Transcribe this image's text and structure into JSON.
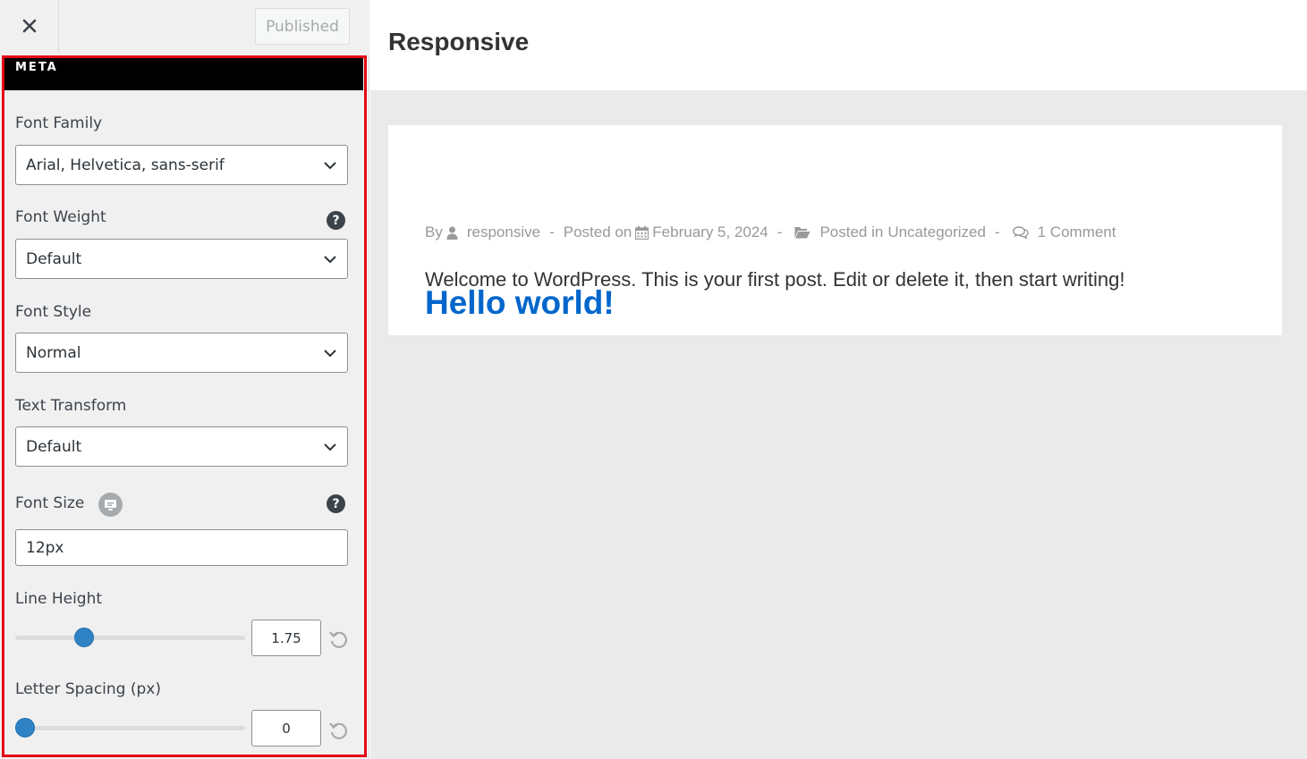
{
  "panel": {
    "close_label": "×",
    "publish_button": "Published",
    "section_title": "META",
    "font_family": {
      "label": "Font Family",
      "value": "Arial, Helvetica, sans-serif"
    },
    "font_weight": {
      "label": "Font Weight",
      "value": "Default",
      "help": "?"
    },
    "font_style": {
      "label": "Font Style",
      "value": "Normal"
    },
    "text_transform": {
      "label": "Text Transform",
      "value": "Default"
    },
    "font_size": {
      "label": "Font Size",
      "value": "12px",
      "help": "?"
    },
    "line_height": {
      "label": "Line Height",
      "value": "1.75",
      "slider_fraction": 0.28
    },
    "letter_spacing": {
      "label": "Letter Spacing (px)",
      "value": "0",
      "slider_fraction": 0.0
    }
  },
  "preview": {
    "site_title": "Responsive",
    "post": {
      "title": "Hello world!",
      "meta": {
        "by": "By",
        "author": "responsive",
        "sep": "-",
        "posted_on": "Posted on",
        "date": "February 5, 2024",
        "posted_in": "Posted in",
        "category": "Uncategorized",
        "comments": "1 Comment"
      },
      "body": "Welcome to WordPress. This is your first post. Edit or delete it, then start writing!"
    }
  },
  "colors": {
    "accent": "#2f83c4",
    "highlight_border": "#e50914",
    "link": "#0066cc",
    "section_bar": "#000000"
  },
  "icons": [
    "close-icon",
    "chevron-down-icon",
    "help-icon",
    "device-desktop-icon",
    "reset-icon",
    "user-icon",
    "calendar-icon",
    "folder-open-icon",
    "comments-icon"
  ]
}
